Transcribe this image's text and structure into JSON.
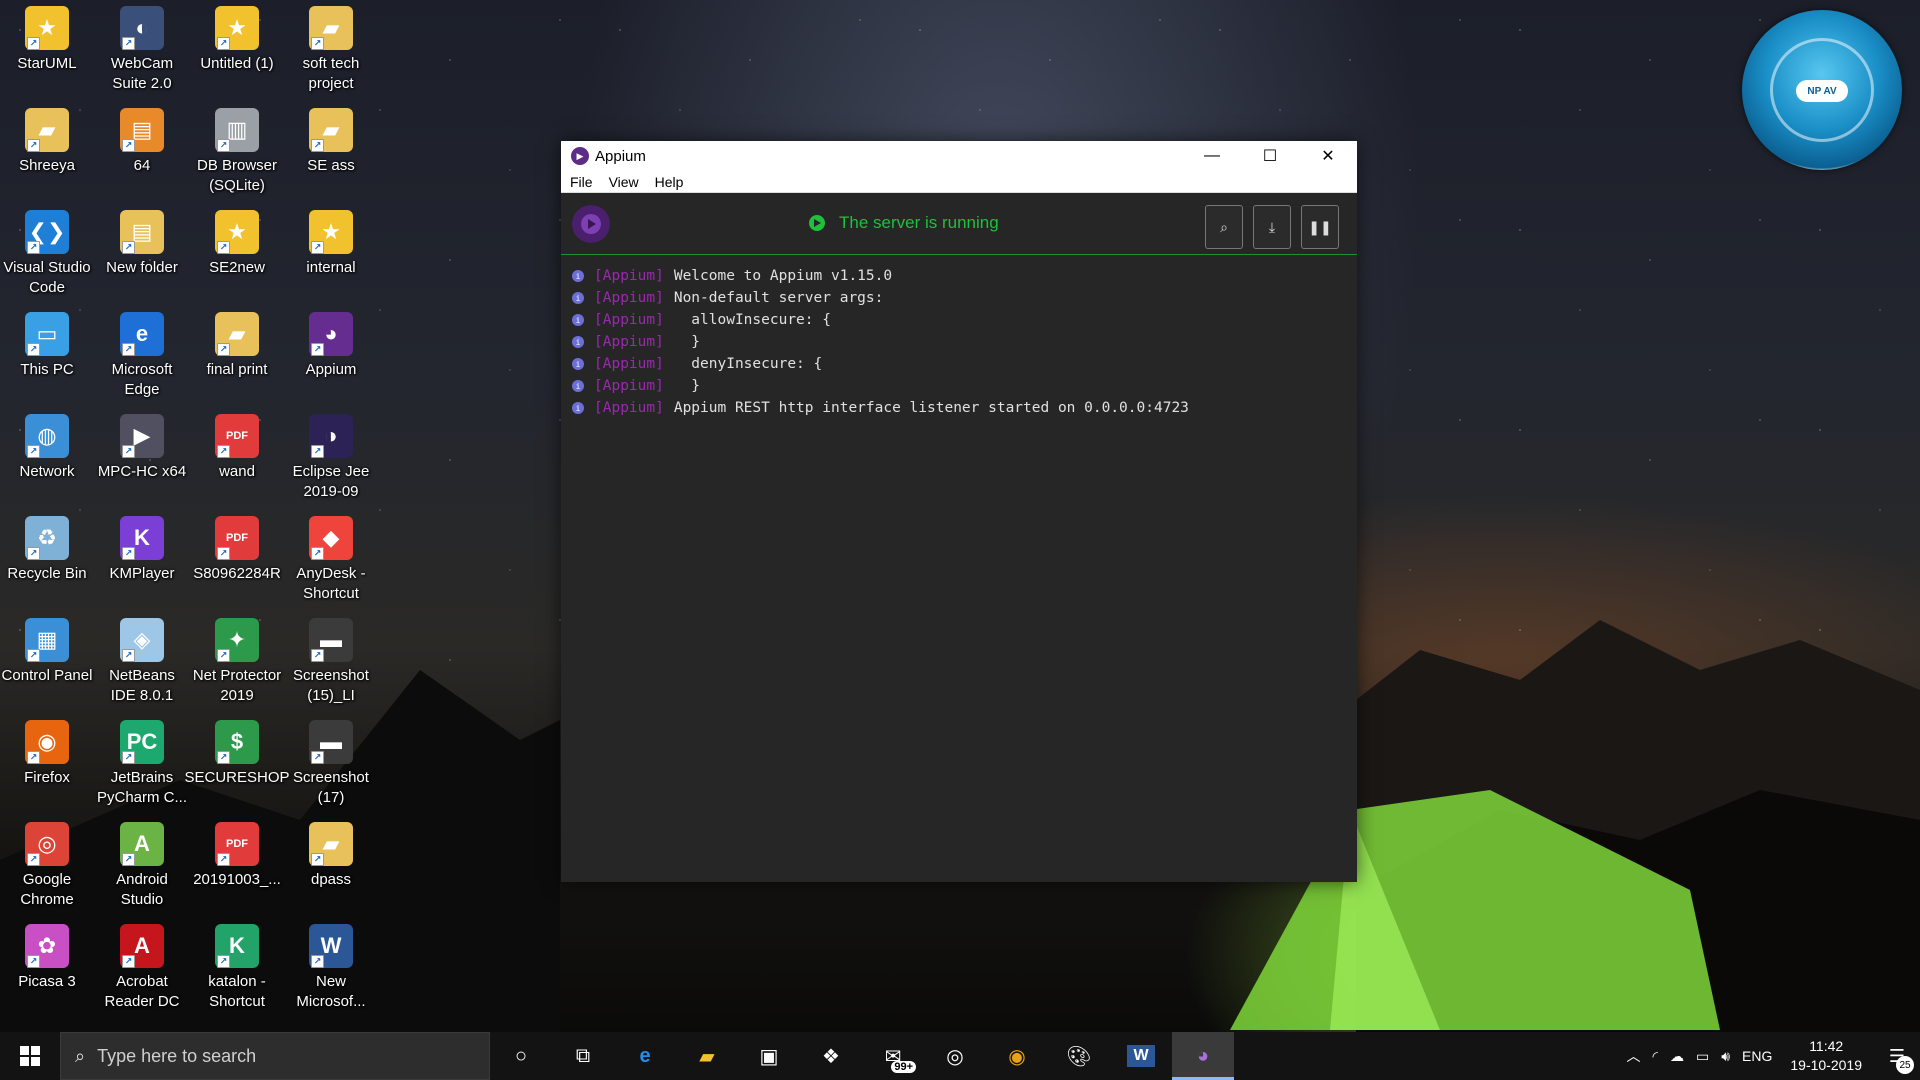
{
  "desktop": {
    "icons": [
      {
        "label": "StarUML",
        "icon": "staruml-icon",
        "color": "#f2c12e",
        "glyph": "★"
      },
      {
        "label": "Shreeya",
        "icon": "folder-icon",
        "color": "#e8c15a",
        "glyph": "▰"
      },
      {
        "label": "Visual Studio Code",
        "icon": "vscode-icon",
        "color": "#1f7ed6",
        "glyph": "❮❯"
      },
      {
        "label": "This PC",
        "icon": "computer-icon",
        "color": "#3aa0e6",
        "glyph": "▭"
      },
      {
        "label": "Network",
        "icon": "network-icon",
        "color": "#3a8fd6",
        "glyph": "◍"
      },
      {
        "label": "Recycle Bin",
        "icon": "recycle-bin-icon",
        "color": "#7fb0d6",
        "glyph": "♻"
      },
      {
        "label": "Control Panel",
        "icon": "control-panel-icon",
        "color": "#3a8fd6",
        "glyph": "▦"
      },
      {
        "label": "Firefox",
        "icon": "firefox-icon",
        "color": "#e8650f",
        "glyph": "◉"
      },
      {
        "label": "Google Chrome",
        "icon": "chrome-icon",
        "color": "#db4437",
        "glyph": "◎"
      },
      {
        "label": "Picasa 3",
        "icon": "picasa-icon",
        "color": "#c94fc4",
        "glyph": "✿"
      },
      {
        "label": "WebCam Suite 2.0",
        "icon": "webcam-icon",
        "color": "#3a4f7a",
        "glyph": "◐"
      },
      {
        "label": "64",
        "icon": "archive-icon",
        "color": "#e88a2a",
        "glyph": "▤"
      },
      {
        "label": "New folder",
        "icon": "folder-archive-icon",
        "color": "#e8c15a",
        "glyph": "▤"
      },
      {
        "label": "Microsoft Edge",
        "icon": "edge-icon",
        "color": "#1e6fd6",
        "glyph": "e"
      },
      {
        "label": "MPC-HC x64",
        "icon": "mpc-hc-icon",
        "color": "#505060",
        "glyph": "▶"
      },
      {
        "label": "KMPlayer",
        "icon": "kmplayer-icon",
        "color": "#7b3fd6",
        "glyph": "K"
      },
      {
        "label": "NetBeans IDE 8.0.1",
        "icon": "netbeans-icon",
        "color": "#9ec6e6",
        "glyph": "◈"
      },
      {
        "label": "JetBrains PyCharm C...",
        "icon": "pycharm-icon",
        "color": "#1ca86e",
        "glyph": "PC"
      },
      {
        "label": "Android Studio",
        "icon": "android-studio-icon",
        "color": "#6ab344",
        "glyph": "A"
      },
      {
        "label": "Acrobat Reader DC",
        "icon": "acrobat-icon",
        "color": "#c4161c",
        "glyph": "A"
      },
      {
        "label": "Untitled (1)",
        "icon": "staruml-icon",
        "color": "#f2c12e",
        "glyph": "★"
      },
      {
        "label": "DB Browser (SQLite)",
        "icon": "database-icon",
        "color": "#9aa0a6",
        "glyph": "▥"
      },
      {
        "label": "SE2new",
        "icon": "staruml-icon",
        "color": "#f2c12e",
        "glyph": "★"
      },
      {
        "label": "final print",
        "icon": "folder-icon",
        "color": "#e8c15a",
        "glyph": "▰"
      },
      {
        "label": "wand",
        "icon": "pdf-icon",
        "color": "#e23b3b",
        "glyph": "PDF"
      },
      {
        "label": "S80962284R",
        "icon": "pdf-icon",
        "color": "#e23b3b",
        "glyph": "PDF"
      },
      {
        "label": "Net Protector 2019",
        "icon": "net-protector-icon",
        "color": "#2c9a4a",
        "glyph": "✦"
      },
      {
        "label": "SECURESHOP",
        "icon": "secureshop-icon",
        "color": "#2c9a4a",
        "glyph": "$"
      },
      {
        "label": "20191003_...",
        "icon": "pdf-icon",
        "color": "#e23b3b",
        "glyph": "PDF"
      },
      {
        "label": "katalon - Shortcut",
        "icon": "katalon-icon",
        "color": "#22a36a",
        "glyph": "K"
      },
      {
        "label": "soft tech project",
        "icon": "folder-icon",
        "color": "#e8c15a",
        "glyph": "▰"
      },
      {
        "label": "SE ass",
        "icon": "folder-icon",
        "color": "#e8c15a",
        "glyph": "▰"
      },
      {
        "label": "internal",
        "icon": "staruml-icon",
        "color": "#f2c12e",
        "glyph": "★"
      },
      {
        "label": "Appium",
        "icon": "appium-icon",
        "color": "#662d91",
        "glyph": "◕"
      },
      {
        "label": "Eclipse Jee 2019-09",
        "icon": "eclipse-icon",
        "color": "#2c2255",
        "glyph": "◑"
      },
      {
        "label": "AnyDesk - Shortcut",
        "icon": "anydesk-icon",
        "color": "#ef443b",
        "glyph": "◆"
      },
      {
        "label": "Screenshot (15)_LI",
        "icon": "image-file-icon",
        "color": "#3b3b3b",
        "glyph": "▬"
      },
      {
        "label": "Screenshot (17)",
        "icon": "image-file-icon",
        "color": "#3b3b3b",
        "glyph": "▬"
      },
      {
        "label": "dpass",
        "icon": "folder-icon",
        "color": "#e8c15a",
        "glyph": "▰"
      },
      {
        "label": "New Microsof...",
        "icon": "word-document-icon",
        "color": "#2b5797",
        "glyph": "W"
      }
    ]
  },
  "window": {
    "title": "Appium",
    "controls": {
      "minimize": "—",
      "maximize": "☐",
      "close": "✕"
    },
    "menu": [
      "File",
      "View",
      "Help"
    ],
    "status_text": "The server is running",
    "status_color": "#1ec03c",
    "toolbar": {
      "search": "⌕",
      "download": "⤓",
      "pause": "❚❚"
    },
    "log_tag": "[Appium]",
    "log_lines": [
      "Welcome to Appium v1.15.0",
      "Non-default server args:",
      "  allowInsecure: {",
      "  }",
      "  denyInsecure: {",
      "  }",
      "Appium REST http interface listener started on 0.0.0.0:4723"
    ]
  },
  "gadget": {
    "badge": "NP AV"
  },
  "taskbar": {
    "search_placeholder": "Type here to search",
    "mail_badge": "99+",
    "language": "ENG",
    "time": "11:42",
    "date": "19-10-2019",
    "notification_count": "25"
  }
}
